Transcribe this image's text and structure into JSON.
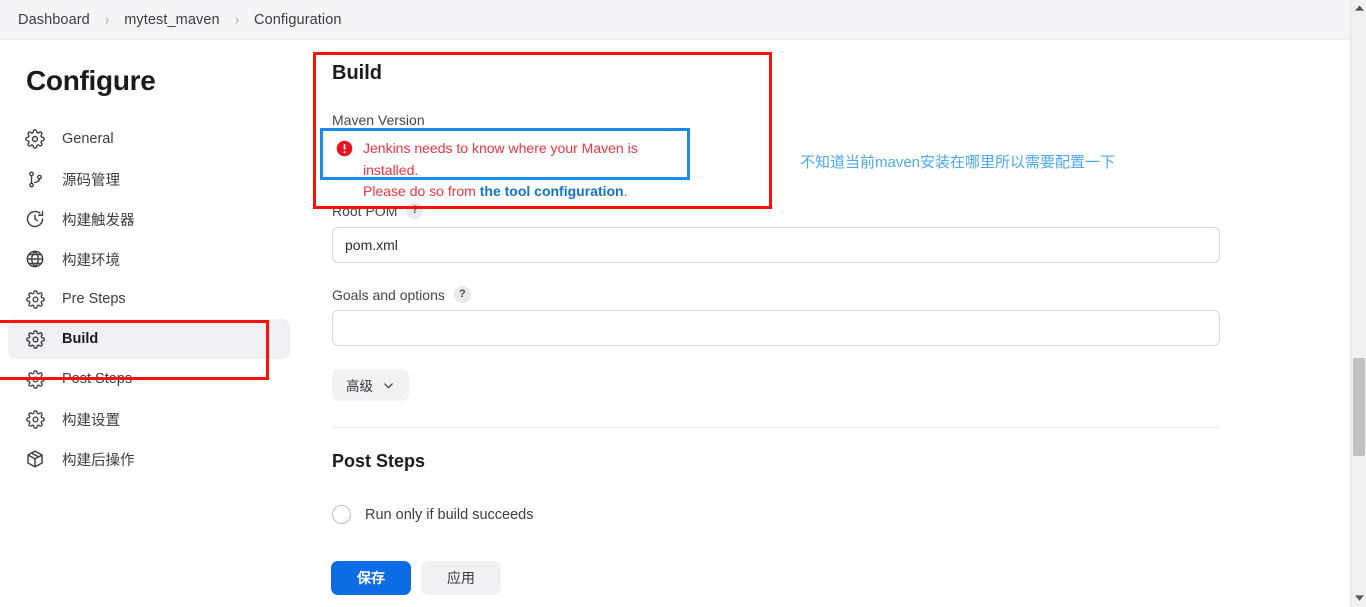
{
  "breadcrumb": {
    "items": [
      "Dashboard",
      "mytest_maven",
      "Configuration"
    ],
    "separator": "›"
  },
  "sidebar": {
    "title": "Configure",
    "items": [
      {
        "label": "General",
        "icon": "gear-icon"
      },
      {
        "label": "源码管理",
        "icon": "git-branch-icon"
      },
      {
        "label": "构建触发器",
        "icon": "clock-icon"
      },
      {
        "label": "构建环境",
        "icon": "globe-icon"
      },
      {
        "label": "Pre Steps",
        "icon": "gear-icon"
      },
      {
        "label": "Build",
        "icon": "gear-icon"
      },
      {
        "label": "Post Steps",
        "icon": "gear-icon"
      },
      {
        "label": "构建设置",
        "icon": "gear-icon"
      },
      {
        "label": "构建后操作",
        "icon": "package-icon"
      }
    ],
    "active_index": 5
  },
  "main": {
    "build_section_title": "Build",
    "maven_version_label": "Maven Version",
    "maven_error": {
      "icon": "error-circle-icon",
      "line1": "Jenkins needs to know where your Maven is installed.",
      "line2_prefix": "Please do so from ",
      "link_text": "the tool configuration",
      "line2_suffix": "."
    },
    "root_pom": {
      "label": "Root POM",
      "help": "?",
      "value": "pom.xml",
      "placeholder": ""
    },
    "goals_options": {
      "label": "Goals and options",
      "help": "?",
      "value": "",
      "placeholder": ""
    },
    "advanced_button": {
      "label": "高级",
      "icon": "chevron-down-icon"
    },
    "post_steps": {
      "title": "Post Steps",
      "radio_label": "Run only if build succeeds",
      "radio_selected": false
    }
  },
  "footer": {
    "save_label": "保存",
    "apply_label": "应用"
  },
  "annotations": {
    "note_text": "不知道当前maven安装在哪里所以需要配置一下",
    "red_color": "#fb1105",
    "blue_color": "#1a8cf0",
    "note_color": "#4aa8f5"
  },
  "colors": {
    "primary_button": "#0b6ce4",
    "link": "#1273cf",
    "error_text": "#f5333f"
  }
}
